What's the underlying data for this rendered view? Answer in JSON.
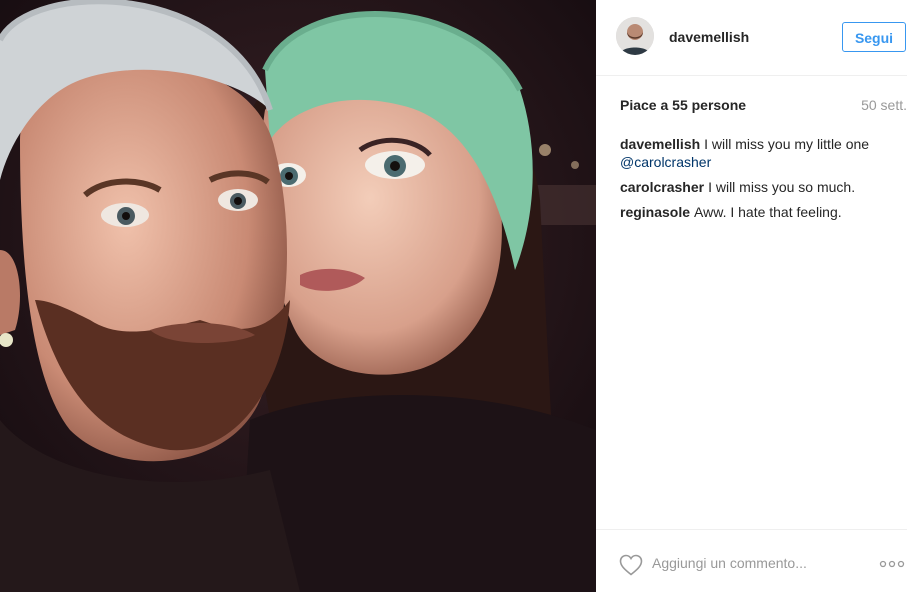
{
  "photo": {
    "alt": "",
    "colors": {
      "background": "#1a0f14",
      "beanie_left": "#cfd3d6",
      "beanie_right": "#7fc6a4"
    }
  },
  "header": {
    "avatar_icon": "user-avatar",
    "username": "davemellish",
    "follow_label": "Segui",
    "accent": "#3897f0"
  },
  "meta": {
    "likes": "Piace a 55 persone",
    "time": "50 sett."
  },
  "comments": [
    {
      "author": "davemellish",
      "text": "I will miss you my little one",
      "mention": "@carolcrasher"
    },
    {
      "author": "carolcrasher",
      "text": "I will miss you so much.",
      "mention": ""
    },
    {
      "author": "reginasole",
      "text": "Aww. I hate that feeling.",
      "mention": ""
    }
  ],
  "footer": {
    "like_icon": "heart-outline",
    "comment_placeholder": "Aggiungi un commento...",
    "more_icon": "ellipsis"
  }
}
